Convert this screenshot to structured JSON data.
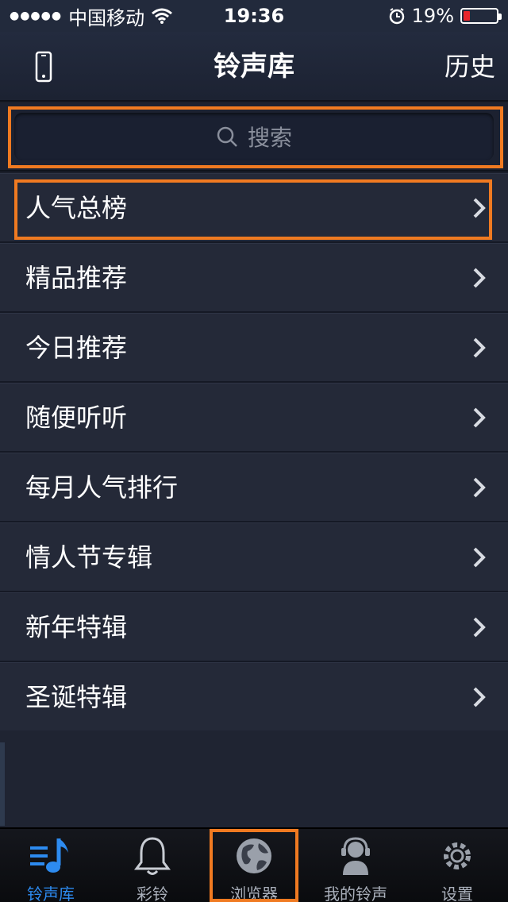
{
  "status_bar": {
    "carrier": "中国移动",
    "time": "19:36",
    "battery_percent": "19%",
    "battery_level": 0.19,
    "icons": [
      "signal-dots",
      "wifi-icon",
      "alarm-icon",
      "battery-icon"
    ]
  },
  "nav": {
    "title": "铃声库",
    "right_label": "历史",
    "left_icon": "phone-icon"
  },
  "search": {
    "placeholder": "搜索",
    "icon": "search-icon"
  },
  "list": [
    {
      "label": "人气总榜"
    },
    {
      "label": "精品推荐"
    },
    {
      "label": "今日推荐"
    },
    {
      "label": "随便听听"
    },
    {
      "label": "每月人气排行"
    },
    {
      "label": "情人节专辑"
    },
    {
      "label": "新年特辑"
    },
    {
      "label": "圣诞特辑"
    }
  ],
  "tabs": [
    {
      "label": "铃声库",
      "icon": "music-note-icon",
      "active": true
    },
    {
      "label": "彩铃",
      "icon": "bell-icon",
      "active": false
    },
    {
      "label": "浏览器",
      "icon": "globe-icon",
      "active": false
    },
    {
      "label": "我的铃声",
      "icon": "headset-user-icon",
      "active": false
    },
    {
      "label": "设置",
      "icon": "gear-icon",
      "active": false
    }
  ],
  "colors": {
    "accent": "#2d8bf0",
    "highlight": "#f07a21",
    "background": "#1b1f2b",
    "battery_low": "#e8262b"
  }
}
